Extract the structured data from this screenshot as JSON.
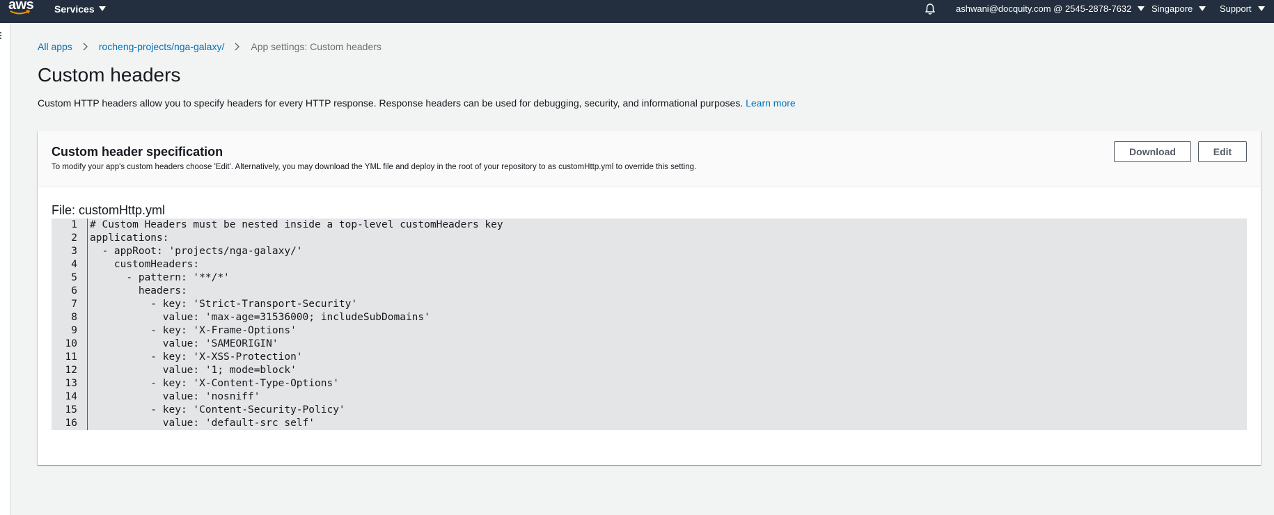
{
  "nav": {
    "logo": "aws",
    "services_label": "Services",
    "account_label": "ashwani@docquity.com @ 2545-2878-7632",
    "region_label": "Singapore",
    "support_label": "Support",
    "notifications_icon": "bell-icon"
  },
  "breadcrumb": {
    "items": [
      {
        "label": "All apps"
      },
      {
        "label": "rocheng-projects/nga-galaxy/"
      },
      {
        "label": "App settings: Custom headers"
      }
    ]
  },
  "page": {
    "title": "Custom headers",
    "description": "Custom HTTP headers allow you to specify headers for every HTTP response. Response headers can be used for debugging, security, and informational purposes.",
    "learn_more": "Learn more"
  },
  "card": {
    "title": "Custom header specification",
    "subtitle": "To modify your app's custom headers choose 'Edit'. Alternatively, you may download the YML file and deploy in the root of your repository to as customHttp.yml to override this setting.",
    "download_label": "Download",
    "edit_label": "Edit",
    "file_label": "File: customHttp.yml"
  },
  "code": {
    "lines": [
      {
        "no": "1",
        "text": "# Custom Headers must be nested inside a top-level customHeaders key"
      },
      {
        "no": "2",
        "text": "applications:"
      },
      {
        "no": "3",
        "text": "  - appRoot: 'projects/nga-galaxy/'"
      },
      {
        "no": "4",
        "text": "    customHeaders:"
      },
      {
        "no": "5",
        "text": "      - pattern: '**/*'"
      },
      {
        "no": "6",
        "text": "        headers:"
      },
      {
        "no": "7",
        "text": "          - key: 'Strict-Transport-Security'"
      },
      {
        "no": "8",
        "text": "            value: 'max-age=31536000; includeSubDomains'"
      },
      {
        "no": "9",
        "text": "          - key: 'X-Frame-Options'"
      },
      {
        "no": "10",
        "text": "            value: 'SAMEORIGIN'"
      },
      {
        "no": "11",
        "text": "          - key: 'X-XSS-Protection'"
      },
      {
        "no": "12",
        "text": "            value: '1; mode=block'"
      },
      {
        "no": "13",
        "text": "          - key: 'X-Content-Type-Options'"
      },
      {
        "no": "14",
        "text": "            value: 'nosniff'"
      },
      {
        "no": "15",
        "text": "          - key: 'Content-Security-Policy'"
      },
      {
        "no": "16",
        "text": "            value: 'default-src self'"
      }
    ]
  },
  "colors": {
    "nav_bg": "#232f3e",
    "link": "#0073bb",
    "page_bg": "#f2f3f3",
    "code_bg": "#e3e5e6"
  }
}
